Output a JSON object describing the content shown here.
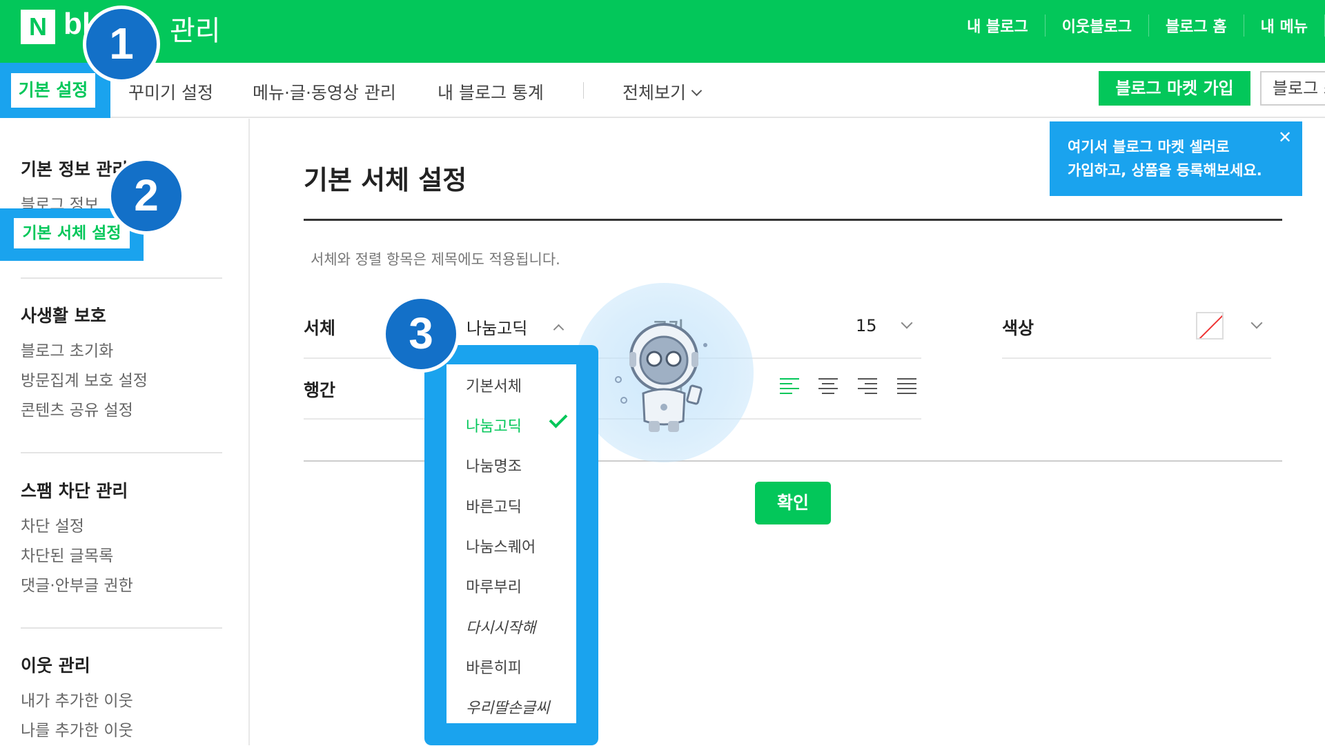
{
  "header": {
    "logo_letter": "N",
    "logo_text": "blog",
    "title": "관리",
    "nav": [
      "내 블로그",
      "이웃블로그",
      "블로그 홈",
      "내 메뉴"
    ]
  },
  "subnav": {
    "tabs": [
      "기본 설정",
      "꾸미기 설정",
      "메뉴·글·동영상 관리",
      "내 블로그 통계",
      "전체보기"
    ],
    "market_button": "블로그 마켓 가입",
    "blog_button": "블로그 쓰기"
  },
  "tooltip": {
    "line1": "여기서 블로그 마켓 셀러로",
    "line2": "가입하고, 상품을 등록해보세요."
  },
  "sidebar": {
    "groups": [
      {
        "title": "기본 정보 관리",
        "items": [
          "블로그 정보",
          "기본 서체 설정"
        ]
      },
      {
        "title": "사생활 보호",
        "items": [
          "블로그 초기화",
          "방문집계 보호 설정",
          "콘텐츠 공유 설정"
        ]
      },
      {
        "title": "스팸 차단 관리",
        "items": [
          "차단 설정",
          "차단된 글목록",
          "댓글·안부글 권한"
        ]
      },
      {
        "title": "이웃 관리",
        "items": [
          "내가 추가한 이웃",
          "나를 추가한 이웃"
        ]
      }
    ]
  },
  "main": {
    "title": "기본 서체 설정",
    "notice": "서체와 정렬 항목은 제목에도 적용됩니다.",
    "font_label": "서체",
    "font_value": "나눔고딕",
    "size_label": "크기",
    "size_value": "15",
    "color_label": "색상",
    "line_label": "행간",
    "align_label": "정렬",
    "confirm": "확인"
  },
  "font_options": [
    "기본서체",
    "나눔고딕",
    "나눔명조",
    "바른고딕",
    "나눔스퀘어",
    "마루부리",
    "다시시작해",
    "바른히피",
    "우리딸손글씨"
  ],
  "selected_font": "나눔고딕",
  "badges": [
    "1",
    "2",
    "3"
  ],
  "colors": {
    "brand_green": "#03c75a",
    "highlight_blue": "#1aa3ee",
    "badge_blue": "#1370c8"
  }
}
